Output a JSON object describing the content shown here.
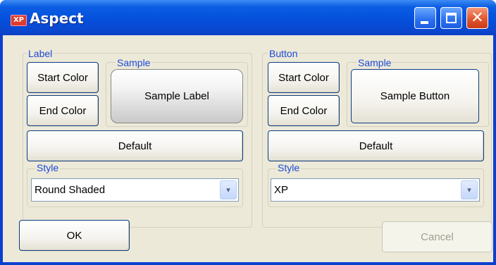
{
  "window": {
    "title": "Aspect",
    "icon_text": "XP",
    "close_glyph": "✕"
  },
  "label_group": {
    "label": "Label",
    "start_color": "Start Color",
    "end_color": "End Color",
    "sample_label": "Sample",
    "sample_text": "Sample Label",
    "default": "Default",
    "style_label": "Style",
    "style_value": "Round Shaded"
  },
  "button_group": {
    "label": "Button",
    "start_color": "Start Color",
    "end_color": "End Color",
    "sample_label": "Sample",
    "sample_text": "Sample Button",
    "default": "Default",
    "style_label": "Style",
    "style_value": "XP"
  },
  "footer": {
    "ok": "OK",
    "cancel": "Cancel"
  },
  "dropdown_arrow": "▾"
}
